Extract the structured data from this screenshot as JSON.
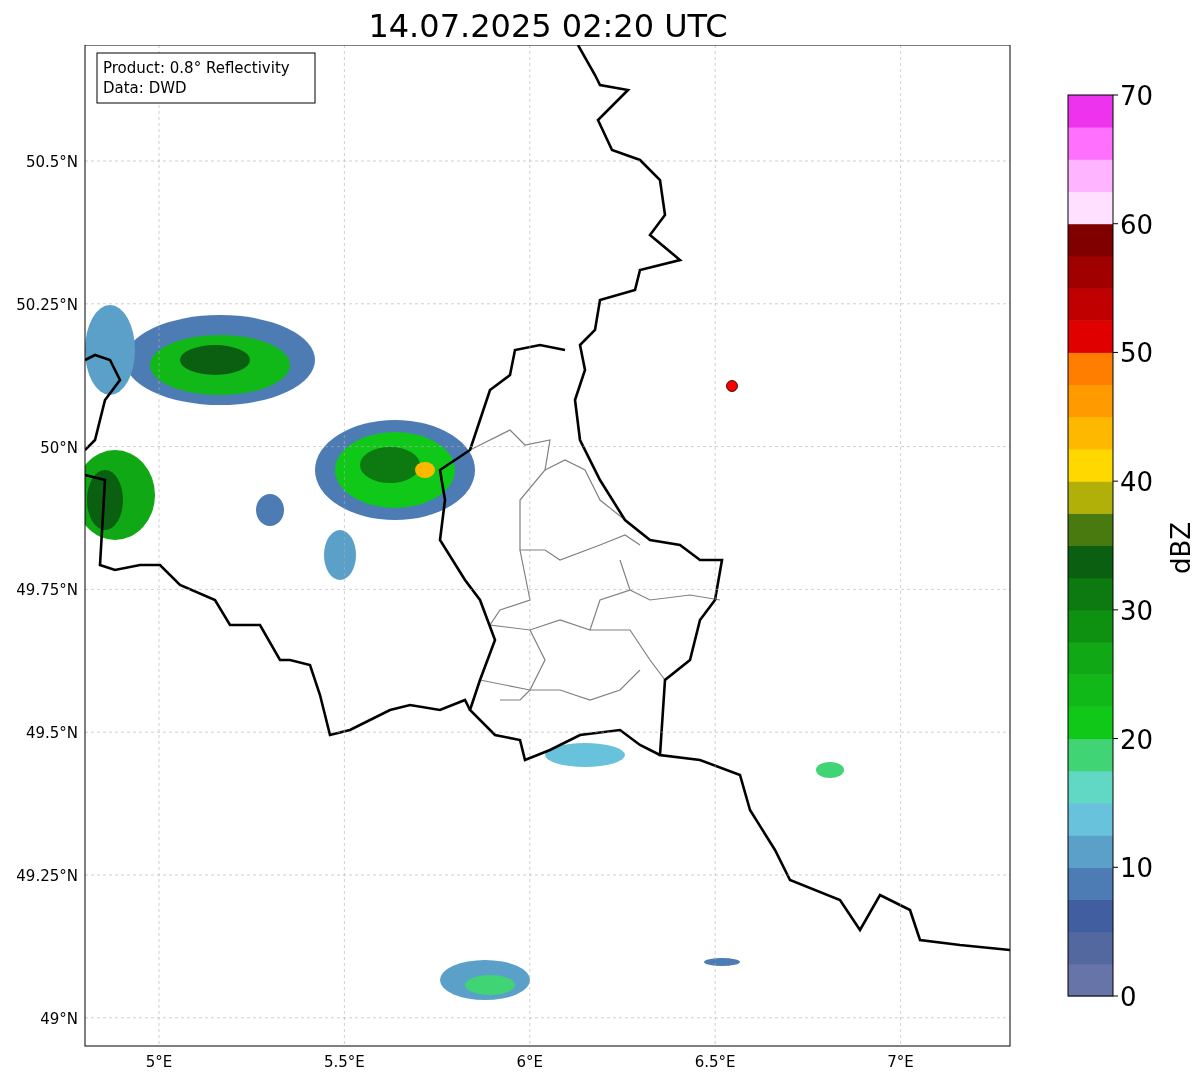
{
  "title": "14.07.2025 02:20 UTC",
  "legend": {
    "lines": [
      "Product: 0.8° Reflectivity",
      "Data: DWD"
    ]
  },
  "y_ticks": [
    "50.5°N",
    "50.25°N",
    "50°N",
    "49.75°N",
    "49.5°N",
    "49.25°N",
    "49°N"
  ],
  "x_ticks": [
    "5°E",
    "5.5°E",
    "6°E",
    "6.5°E",
    "7°E"
  ],
  "colorbar": {
    "label": "dBZ",
    "ticks": [
      "70",
      "60",
      "50",
      "40",
      "30",
      "20",
      "10",
      "0"
    ],
    "bands": [
      {
        "color": "#6674a8"
      },
      {
        "color": "#5468a0"
      },
      {
        "color": "#415ea0"
      },
      {
        "color": "#4d7cb4"
      },
      {
        "color": "#5aa0c8"
      },
      {
        "color": "#68c2dc"
      },
      {
        "color": "#60d8c4"
      },
      {
        "color": "#40d474"
      },
      {
        "color": "#10c818"
      },
      {
        "color": "#10b818"
      },
      {
        "color": "#10a814"
      },
      {
        "color": "#0e9010"
      },
      {
        "color": "#0c7a10"
      },
      {
        "color": "#0a6010"
      },
      {
        "color": "#487a10"
      },
      {
        "color": "#b0b008"
      },
      {
        "color": "#ffd800"
      },
      {
        "color": "#ffb800"
      },
      {
        "color": "#ff9a00"
      },
      {
        "color": "#ff7e00"
      },
      {
        "color": "#e00000"
      },
      {
        "color": "#c00000"
      },
      {
        "color": "#a00000"
      },
      {
        "color": "#800000"
      },
      {
        "color": "#ffe0ff"
      },
      {
        "color": "#ffb4ff"
      },
      {
        "color": "#ff70ff"
      },
      {
        "color": "#ee33ee"
      }
    ]
  }
}
